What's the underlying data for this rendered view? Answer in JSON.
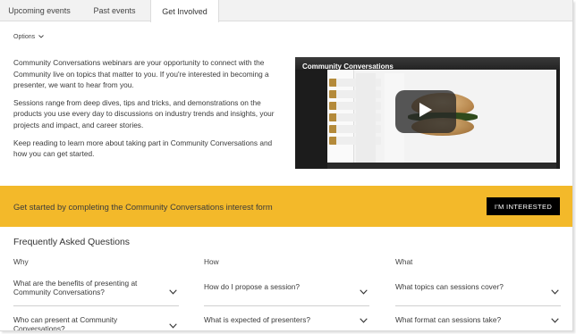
{
  "tabs": {
    "upcoming": "Upcoming events",
    "past": "Past events",
    "involved": "Get Involved"
  },
  "options_label": "Options",
  "intro": {
    "p1": "Community Conversations webinars are your opportunity to connect with the Community live on topics that matter to you. If you're interested in becoming a presenter, we want to hear from you.",
    "p2": "Sessions range from deep dives, tips and tricks, and demonstrations on the products you use every day to discussions on industry trends and insights, your projects and impact, and career stories.",
    "p3": "Keep reading to learn more about taking part in Community Conversations and how you can get started."
  },
  "video": {
    "title": "Community Conversations"
  },
  "banner": {
    "text": "Get started by completing the Community Conversations interest form",
    "button": "I'M INTERESTED",
    "color": "#f3b92a"
  },
  "faq": {
    "title": "Frequently Asked Questions",
    "columns": [
      {
        "heading": "Why",
        "q1": "What are the benefits of presenting at Community Conversations?",
        "q2": "Who can present at Community Conversations?"
      },
      {
        "heading": "How",
        "q1": "How do I propose a session?",
        "q2": "What is expected of presenters?"
      },
      {
        "heading": "What",
        "q1": "What topics can sessions cover?",
        "q2": "What format can sessions take?"
      }
    ]
  },
  "icons": {
    "options": "chevron-down-icon",
    "faq": "chevron-down-icon",
    "video": "play-icon"
  }
}
